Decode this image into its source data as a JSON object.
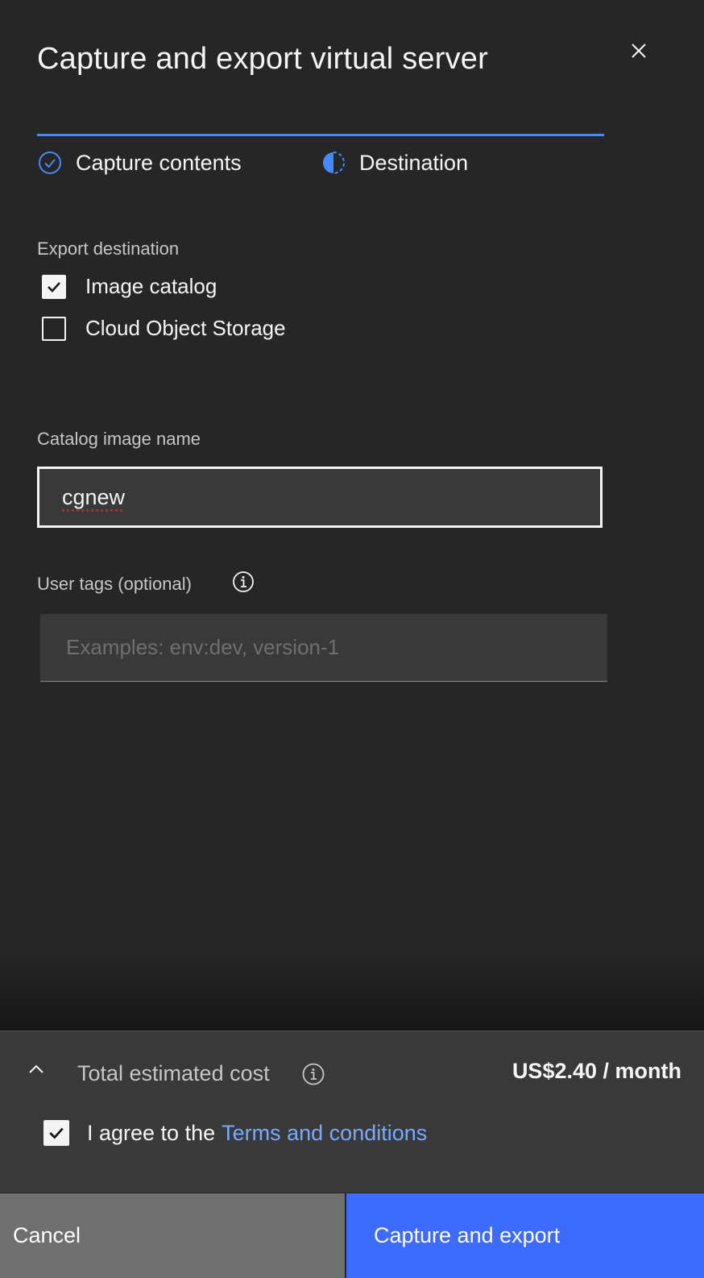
{
  "modal": {
    "title": "Capture and export virtual server",
    "close_icon": "close-icon"
  },
  "progress": {
    "steps": [
      {
        "label": "Capture contents",
        "state": "complete",
        "icon": "checkmark-outline-icon"
      },
      {
        "label": "Destination",
        "state": "current",
        "icon": "incomplete-icon"
      }
    ]
  },
  "export_destination": {
    "label": "Export destination",
    "options": [
      {
        "label": "Image catalog",
        "checked": true
      },
      {
        "label": "Cloud Object Storage",
        "checked": false
      }
    ]
  },
  "catalog_image_name": {
    "label": "Catalog image name",
    "value": "cgnew"
  },
  "user_tags": {
    "label": "User tags (optional)",
    "placeholder": "Examples: env:dev, version-1",
    "value": ""
  },
  "cost": {
    "label": "Total estimated cost",
    "value": "US$2.40 / month",
    "expand_icon": "chevron-up-icon"
  },
  "terms": {
    "checked": true,
    "prefix": "I agree to the",
    "link": "Terms and conditions"
  },
  "actions": {
    "cancel": "Cancel",
    "primary": "Capture and export"
  },
  "colors": {
    "background": "#262626",
    "accent": "#4589ff",
    "primary_button": "#3d6bff",
    "link": "#78a9ff"
  }
}
